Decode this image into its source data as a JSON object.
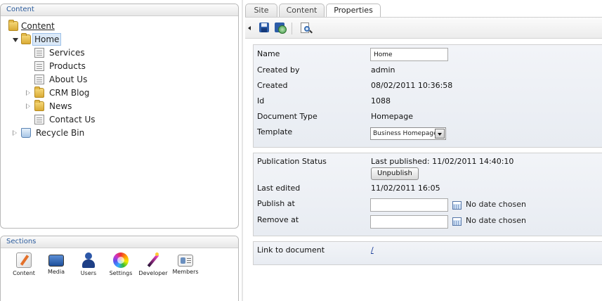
{
  "content_panel": {
    "title": "Content",
    "tree": {
      "root": "Content",
      "home": "Home",
      "children": [
        "Services",
        "Products",
        "About Us",
        "CRM Blog",
        "News",
        "Contact Us"
      ],
      "recycle_bin": "Recycle Bin"
    }
  },
  "sections_panel": {
    "title": "Sections",
    "items": [
      {
        "label": "Content",
        "icon": "pencil-document-icon"
      },
      {
        "label": "Media",
        "icon": "monitor-icon"
      },
      {
        "label": "Users",
        "icon": "user-icon"
      },
      {
        "label": "Settings",
        "icon": "color-wheel-icon"
      },
      {
        "label": "Developer",
        "icon": "magic-wand-icon"
      },
      {
        "label": "Members",
        "icon": "member-card-icon"
      }
    ]
  },
  "tabs": [
    {
      "label": "Site",
      "active": false
    },
    {
      "label": "Content",
      "active": false
    },
    {
      "label": "Properties",
      "active": true
    }
  ],
  "toolbar": {
    "icons": [
      "collapse-arrow-icon",
      "save-icon",
      "save-and-publish-icon",
      "preview-icon"
    ]
  },
  "properties": {
    "name_label": "Name",
    "name_value": "Home",
    "created_by_label": "Created by",
    "created_by_value": "admin",
    "created_label": "Created",
    "created_value": "08/02/2011 10:36:58",
    "id_label": "Id",
    "id_value": "1088",
    "doctype_label": "Document Type",
    "doctype_value": "Homepage",
    "template_label": "Template",
    "template_value": "Business Homepage"
  },
  "publication": {
    "status_label": "Publication Status",
    "status_value": "Last published: 11/02/2011 14:40:10",
    "unpublish_label": "Unpublish",
    "last_edited_label": "Last edited",
    "last_edited_value": "11/02/2011 16:05",
    "publish_at_label": "Publish at",
    "publish_at_value": "No date chosen",
    "remove_at_label": "Remove at",
    "remove_at_value": "No date chosen"
  },
  "link_section": {
    "label": "Link to document",
    "value": "/"
  },
  "colors": {
    "panel_title": "#2a5a9b",
    "link": "#1d3f9a",
    "selected_node_bg": "#dbe9f8"
  }
}
